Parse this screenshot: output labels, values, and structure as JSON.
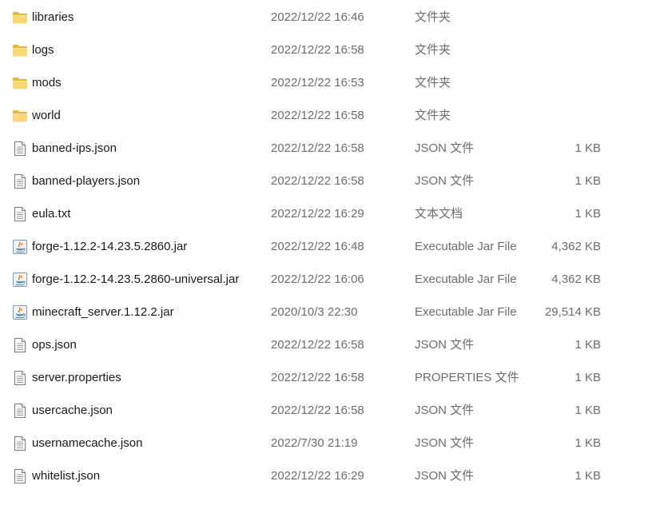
{
  "colors": {
    "folder": "#f8d775",
    "folder_dark": "#e8b73e",
    "text_primary": "#1a1a1a",
    "text_secondary": "#6d6d6d"
  },
  "files": [
    {
      "name": "libraries",
      "date": "2022/12/22 16:46",
      "type": "文件夹",
      "size": "",
      "icon": "folder-icon"
    },
    {
      "name": "logs",
      "date": "2022/12/22 16:58",
      "type": "文件夹",
      "size": "",
      "icon": "folder-icon"
    },
    {
      "name": "mods",
      "date": "2022/12/22 16:53",
      "type": "文件夹",
      "size": "",
      "icon": "folder-icon"
    },
    {
      "name": "world",
      "date": "2022/12/22 16:58",
      "type": "文件夹",
      "size": "",
      "icon": "folder-icon"
    },
    {
      "name": "banned-ips.json",
      "date": "2022/12/22 16:58",
      "type": "JSON 文件",
      "size": "1 KB",
      "icon": "document-icon"
    },
    {
      "name": "banned-players.json",
      "date": "2022/12/22 16:58",
      "type": "JSON 文件",
      "size": "1 KB",
      "icon": "document-icon"
    },
    {
      "name": "eula.txt",
      "date": "2022/12/22 16:29",
      "type": "文本文档",
      "size": "1 KB",
      "icon": "document-icon"
    },
    {
      "name": "forge-1.12.2-14.23.5.2860.jar",
      "date": "2022/12/22 16:48",
      "type": "Executable Jar File",
      "size": "4,362 KB",
      "icon": "java-jar-icon"
    },
    {
      "name": "forge-1.12.2-14.23.5.2860-universal.jar",
      "date": "2022/12/22 16:06",
      "type": "Executable Jar File",
      "size": "4,362 KB",
      "icon": "java-jar-icon"
    },
    {
      "name": "minecraft_server.1.12.2.jar",
      "date": "2020/10/3 22:30",
      "type": "Executable Jar File",
      "size": "29,514 KB",
      "icon": "java-jar-icon"
    },
    {
      "name": "ops.json",
      "date": "2022/12/22 16:58",
      "type": "JSON 文件",
      "size": "1 KB",
      "icon": "document-icon"
    },
    {
      "name": "server.properties",
      "date": "2022/12/22 16:58",
      "type": "PROPERTIES 文件",
      "size": "1 KB",
      "icon": "document-icon"
    },
    {
      "name": "usercache.json",
      "date": "2022/12/22 16:58",
      "type": "JSON 文件",
      "size": "1 KB",
      "icon": "document-icon"
    },
    {
      "name": "usernamecache.json",
      "date": "2022/7/30 21:19",
      "type": "JSON 文件",
      "size": "1 KB",
      "icon": "document-icon"
    },
    {
      "name": "whitelist.json",
      "date": "2022/12/22 16:29",
      "type": "JSON 文件",
      "size": "1 KB",
      "icon": "document-icon"
    }
  ]
}
